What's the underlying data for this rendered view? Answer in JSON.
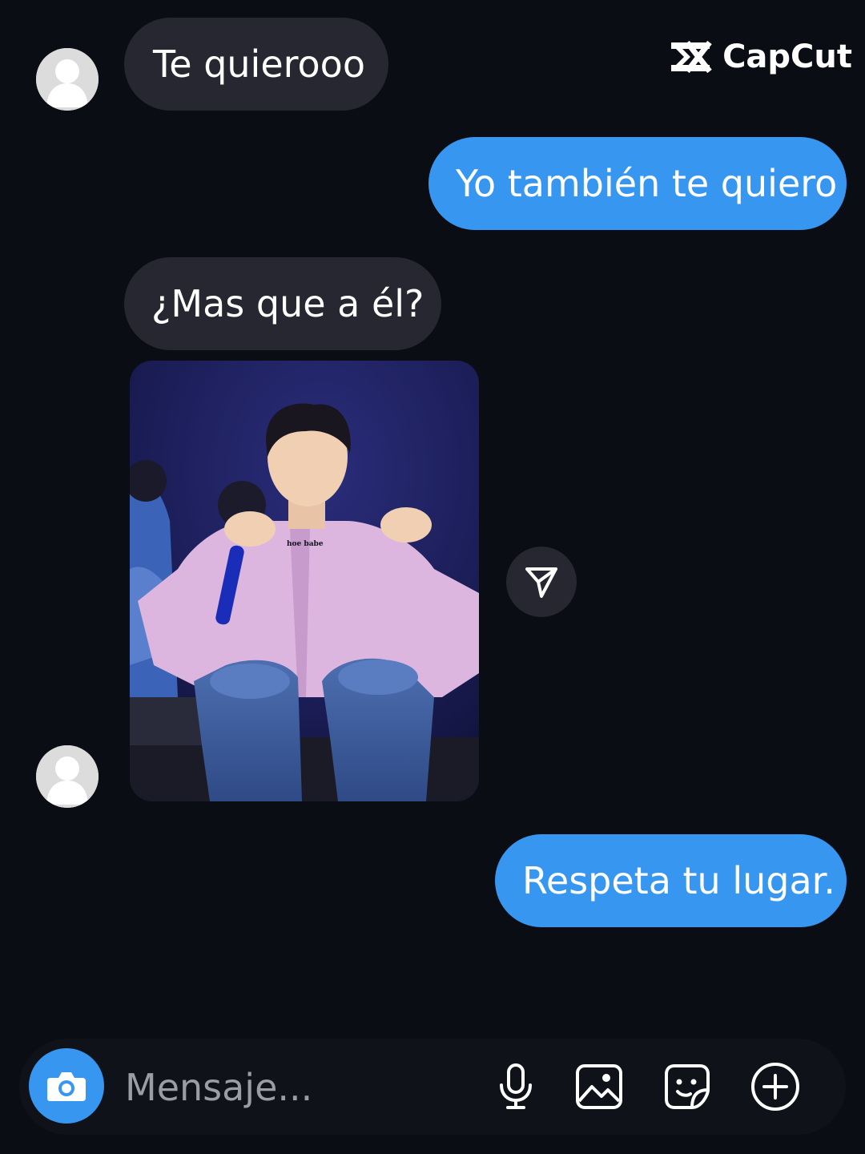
{
  "watermark": {
    "text": "CapCut"
  },
  "messages": [
    {
      "id": "m1",
      "direction": "incoming",
      "text": "Te quierooo"
    },
    {
      "id": "m2",
      "direction": "outgoing",
      "text": "Yo también te quiero"
    },
    {
      "id": "m3",
      "direction": "incoming",
      "text": "¿Mas que a él?"
    },
    {
      "id": "m4",
      "direction": "incoming",
      "type": "photo",
      "photo_caption": "hoe babe"
    },
    {
      "id": "m5",
      "direction": "outgoing",
      "text": "Respeta tu lugar."
    }
  ],
  "composer": {
    "placeholder": "Mensaje...",
    "icons": [
      "camera-icon",
      "microphone-icon",
      "gallery-icon",
      "sticker-icon",
      "plus-icon"
    ]
  },
  "colors": {
    "background": "#0b0d14",
    "incoming_bubble": "#262730",
    "outgoing_bubble": "#3797f0",
    "accent": "#3797f0"
  }
}
